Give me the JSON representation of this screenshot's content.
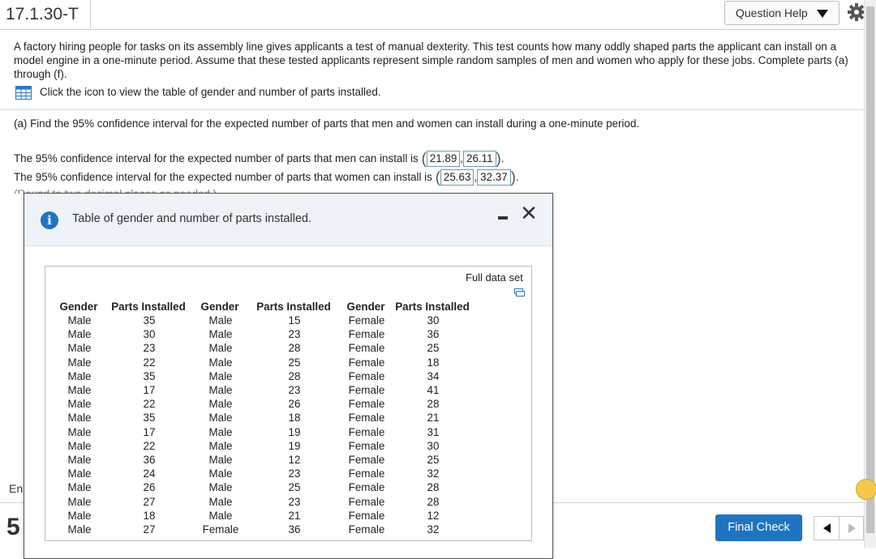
{
  "header": {
    "problem_id": "17.1.30-T",
    "question_help_label": "Question Help",
    "settings_icon": "gear-icon"
  },
  "problem": {
    "statement": "A factory hiring people for tasks on its assembly line gives applicants a test of manual dexterity. This test counts how many oddly shaped parts the applicant can install on a model engine in a one-minute period. Assume that these tested applicants represent simple random samples of men and women who apply for these jobs. Complete parts (a) through (f).",
    "table_link_text": "Click the icon to view the table of gender and number of parts installed.",
    "table_icon": "table-grid-icon"
  },
  "part_a": {
    "question": "(a)  Find the 95% confidence interval for the expected number of parts that men and women can install during a one-minute period.",
    "men_text": "The 95% confidence interval for the expected number of parts that men can install is",
    "men_low": "21.89",
    "men_high": "26.11",
    "women_text": "The 95% confidence interval for the expected number of parts that women can install is",
    "women_low": "25.63",
    "women_high": "32.37",
    "round_note": "(Round to two decimal places as needed.)"
  },
  "background": {
    "partial_text": "En",
    "partial_number": "5"
  },
  "footer": {
    "final_check_label": "Final Check"
  },
  "modal": {
    "title": "Table of gender and number of parts installed.",
    "full_data_set_label": "Full data set",
    "headers": [
      "Gender",
      "Parts Installed",
      "Gender",
      "Parts Installed",
      "Gender",
      "Parts Installed"
    ],
    "rows": [
      [
        "Male",
        "35",
        "Male",
        "15",
        "Female",
        "30"
      ],
      [
        "Male",
        "30",
        "Male",
        "23",
        "Female",
        "36"
      ],
      [
        "Male",
        "23",
        "Male",
        "28",
        "Female",
        "25"
      ],
      [
        "Male",
        "22",
        "Male",
        "25",
        "Female",
        "18"
      ],
      [
        "Male",
        "35",
        "Male",
        "28",
        "Female",
        "34"
      ],
      [
        "Male",
        "17",
        "Male",
        "23",
        "Female",
        "41"
      ],
      [
        "Male",
        "22",
        "Male",
        "26",
        "Female",
        "28"
      ],
      [
        "Male",
        "35",
        "Male",
        "18",
        "Female",
        "21"
      ],
      [
        "Male",
        "17",
        "Male",
        "19",
        "Female",
        "31"
      ],
      [
        "Male",
        "22",
        "Male",
        "19",
        "Female",
        "30"
      ],
      [
        "Male",
        "36",
        "Male",
        "12",
        "Female",
        "25"
      ],
      [
        "Male",
        "24",
        "Male",
        "23",
        "Female",
        "32"
      ],
      [
        "Male",
        "26",
        "Male",
        "25",
        "Female",
        "28"
      ],
      [
        "Male",
        "27",
        "Male",
        "23",
        "Female",
        "28"
      ],
      [
        "Male",
        "18",
        "Male",
        "21",
        "Female",
        "12"
      ],
      [
        "Male",
        "27",
        "Female",
        "36",
        "Female",
        "32"
      ]
    ]
  },
  "colors": {
    "accent": "#1f74c2",
    "answer_border": "#6a9bb5",
    "modal_header_bg": "#eef3fa"
  }
}
